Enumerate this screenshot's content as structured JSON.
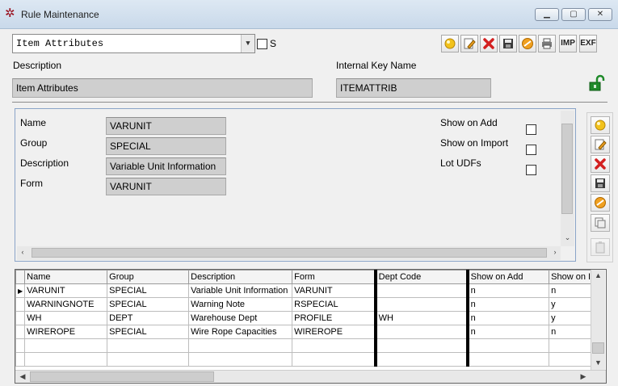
{
  "window": {
    "title": "Rule Maintenance",
    "controls": {
      "minimize": "▁",
      "maximize": "▢",
      "close": "✕"
    }
  },
  "header": {
    "rule_select": "Item Attributes",
    "s_checkbox_label": "S",
    "description_label": "Description",
    "description_value": "Item Attributes",
    "internal_key_label": "Internal Key Name",
    "internal_key_value": "ITEMATTRIB",
    "imp_label": "IMP",
    "exp_label": "EXF"
  },
  "detail": {
    "name_label": "Name",
    "name_value": "VARUNIT",
    "group_label": "Group",
    "group_value": "SPECIAL",
    "description_label": "Description",
    "description_value": "Variable Unit Information",
    "form_label": "Form",
    "form_value": "VARUNIT",
    "show_on_add_label": "Show on Add",
    "show_on_import_label": "Show on Import",
    "lot_udfs_label": "Lot UDFs"
  },
  "grid": {
    "columns": [
      "Name",
      "Group",
      "Description",
      "Form",
      "Dept Code",
      "Show on Add",
      "Show on I"
    ],
    "rows": [
      [
        "VARUNIT",
        "SPECIAL",
        "Variable Unit Information",
        "VARUNIT",
        "",
        "n",
        "n"
      ],
      [
        "WARNINGNOTE",
        "SPECIAL",
        "Warning Note",
        "RSPECIAL",
        "",
        "n",
        "y"
      ],
      [
        "WH",
        "DEPT",
        "Warehouse Dept",
        "PROFILE",
        "WH",
        "n",
        "y"
      ],
      [
        "WIREROPE",
        "SPECIAL",
        "Wire Rope Capacities",
        "WIREROPE",
        "",
        "n",
        "n"
      ]
    ]
  },
  "colors": {
    "add": "#f2c21b",
    "delete": "#d32020",
    "cancel": "#f0a020",
    "unlock": "#1f8a2a",
    "panel_border": "#8aa4c8"
  }
}
